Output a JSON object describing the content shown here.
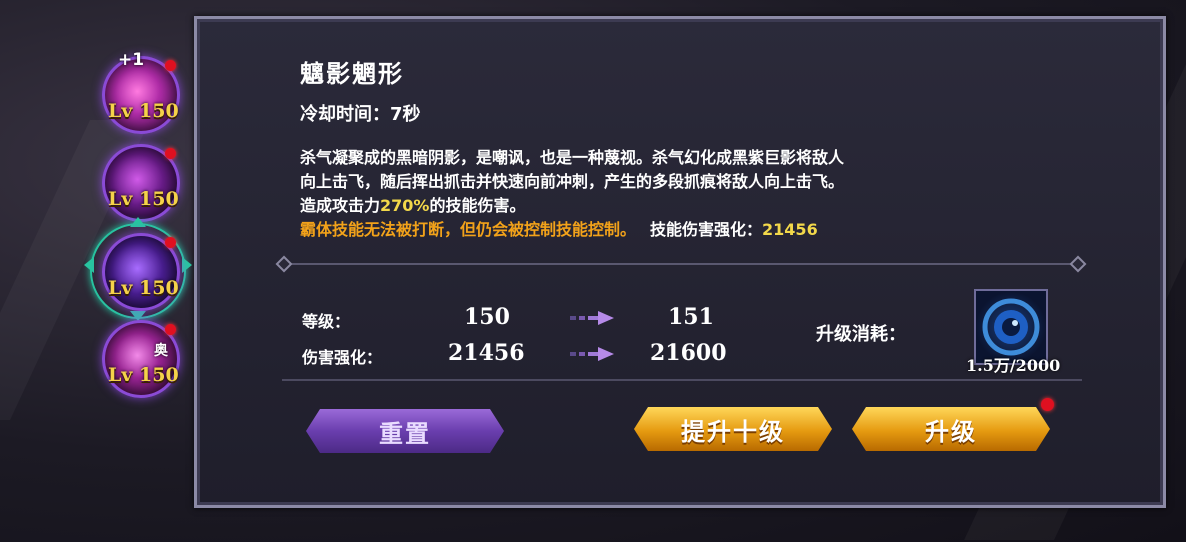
{
  "skill_list": [
    {
      "level": "Lv 150",
      "badge": "+1",
      "tag": ""
    },
    {
      "level": "Lv 150",
      "badge": "",
      "tag": ""
    },
    {
      "level": "Lv 150",
      "badge": "",
      "tag": ""
    },
    {
      "level": "Lv 150",
      "badge": "",
      "tag": "奥"
    }
  ],
  "skill": {
    "name": "魑影魍形",
    "cooldown": "冷却时间：7秒",
    "desc_line1": "杀气凝聚成的黑暗阴影，是嘲讽，也是一种蔑视。杀气幻化成黑紫巨影将敌人",
    "desc_line2": "向上击飞，随后挥出抓击并快速向前冲刺，产生的多段抓痕将敌人向上击飞。",
    "desc_line3_prefix": "造成攻击力",
    "desc_line3_percent": "270%",
    "desc_line3_suffix": "的技能伤害。",
    "super_armor_note": "霸体技能无法被打断，但仍会被控制技能控制。",
    "damage_boost_label": "技能伤害强化：",
    "damage_boost_value": "21456"
  },
  "stats": {
    "level_label": "等级：",
    "level_current": "150",
    "level_next": "151",
    "boost_label": "伤害强化：",
    "boost_current": "21456",
    "boost_next": "21600"
  },
  "cost": {
    "label": "升级消耗：",
    "count": "1.5万/2000",
    "item_icon": "blue-eye-orb-icon"
  },
  "buttons": {
    "reset": "重置",
    "upgrade_ten": "提升十级",
    "upgrade": "升级"
  },
  "colors": {
    "highlight_yellow": "#f2d84a",
    "warning_orange": "#f2a21a",
    "notify_red": "#e01020"
  }
}
